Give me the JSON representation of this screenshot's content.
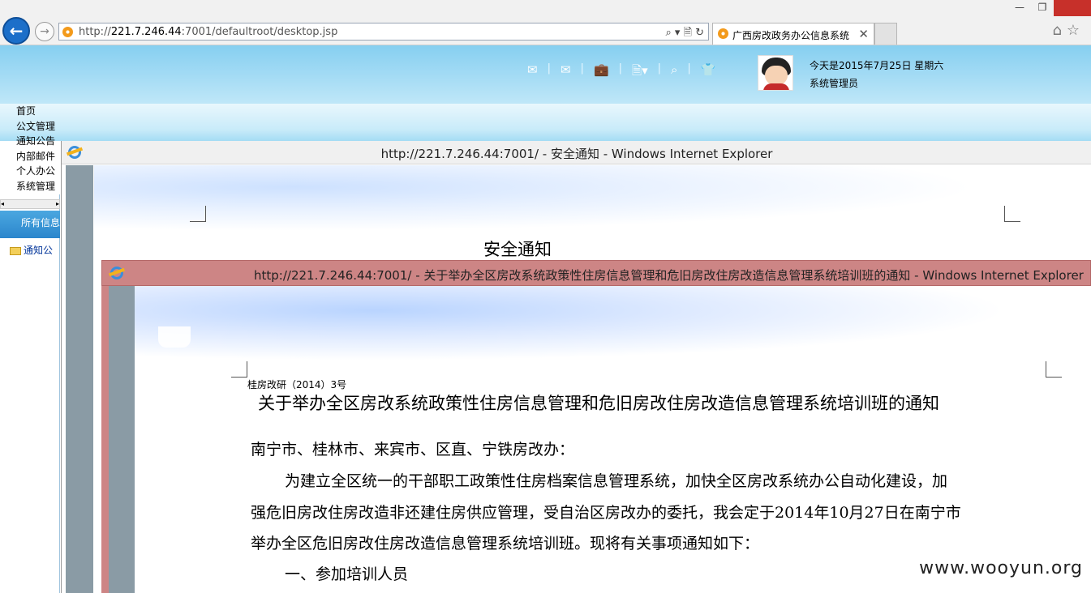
{
  "browser": {
    "back_icon": "back-arrow-icon",
    "forward_icon": "forward-arrow-icon",
    "url_prefix": "http://",
    "url_host": "221.7.246.44",
    "url_path": ":7001/defaultroot/desktop.jsp",
    "address_tools": "⌕ ▾ 🗎 ↻",
    "tab_title": "广西房改政务办公信息系统",
    "tab_close": "✕",
    "window_controls": {
      "minimize": "—",
      "restore": "❐"
    },
    "right_icons": "⌂☆"
  },
  "header": {
    "tool_icons": [
      "✉",
      "✉",
      "💼",
      "🗎▾",
      "⌕",
      "👕"
    ],
    "date_text": "今天是2015年7月25日  星期六",
    "user_text": "系统管理员"
  },
  "menu": {
    "items": [
      "首页",
      "公文管理",
      "通知公告",
      "内部邮件",
      "个人办公",
      "系统管理"
    ]
  },
  "sidebar": {
    "scroll_left": "◂",
    "scroll_right": "▸",
    "header": "所有信息",
    "tree_item": "通知公"
  },
  "popup1": {
    "title": "http://221.7.246.44:7001/ - 安全通知 - Windows Internet Explorer",
    "heading": "安全通知"
  },
  "popup2": {
    "title": "http://221.7.246.44:7001/ - 关于举办全区房改系统政策性住房信息管理和危旧房改住房改造信息管理系统培训班的通知 - Windows Internet Explorer"
  },
  "document": {
    "number": "桂房改研（2014）3号",
    "title": "关于举办全区房改系统政策性住房信息管理和危旧房改住房改造信息管理系统培训班的通知",
    "salutation": "南宁市、桂林市、来宾市、区直、宁铁房改办：",
    "paragraph_line1": "为建立全区统一的干部职工政策性住房档案信息管理系统，加快全区房改系统办公自动化建设，加",
    "paragraph_line2": "强危旧房改住房改造非还建住房供应管理，受自治区房改办的委托，我会定于2014年10月27日在南宁市",
    "paragraph_line3": "举办全区危旧房改住房改造信息管理系统培训班。现将有关事项通知如下：",
    "section1": "一、参加培训人员"
  },
  "watermark": "www.wooyun.org",
  "colors": {
    "header_blue": "#86cff0",
    "popup2_titlebar": "#cd8585",
    "gutter_gray": "#8a9ba5",
    "back_button": "#1c6fc9"
  }
}
